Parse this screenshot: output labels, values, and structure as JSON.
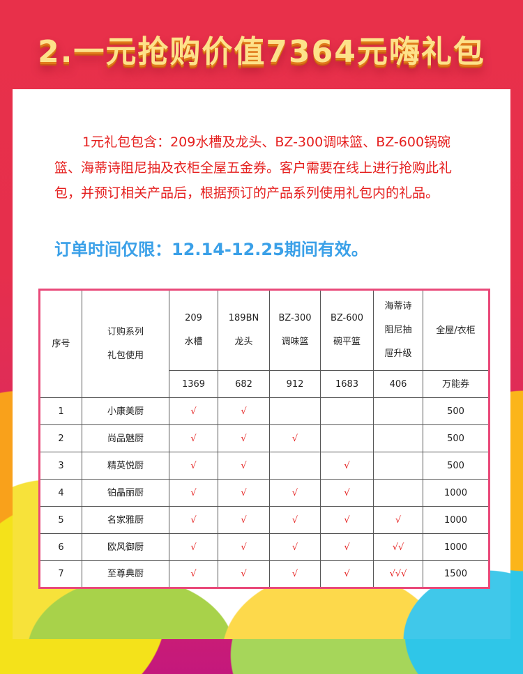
{
  "title": "2.一元抢购价值7364元嗨礼包",
  "intro": "1元礼包包含：209水槽及龙头、BZ-300调味篮、BZ-600锅碗篮、海蒂诗阻尼抽及衣柜全屋五金券。客户需要在线上进行抢购此礼包，并预订相关产品后，根据预订的产品系列使用礼包内的礼品。",
  "period": "订单时间仅限：12.14-12.25期间有效。",
  "table": {
    "h_no": "序号",
    "h_series_1": "订购系列",
    "h_series_2": "礼包使用",
    "cols": [
      {
        "l1": "209",
        "l2": "水槽",
        "value": "1369"
      },
      {
        "l1": "189BN",
        "l2": "龙头",
        "value": "682"
      },
      {
        "l1": "BZ-300",
        "l2": "调味篮",
        "value": "912"
      },
      {
        "l1": "BZ-600",
        "l2": "碗平篮",
        "value": "1683"
      },
      {
        "l1": "海蒂诗",
        "l2": "阻尼抽",
        "l3": "屉升级",
        "value": "406"
      }
    ],
    "h_last": "全屋/衣柜",
    "h_last_sub": "万能券",
    "rows": [
      {
        "no": "1",
        "name": "小康美厨",
        "c": [
          "√",
          "√",
          "",
          "",
          "",
          ""
        ],
        "v": "500"
      },
      {
        "no": "2",
        "name": "尚品魅厨",
        "c": [
          "√",
          "√",
          "√",
          "",
          ""
        ],
        "v": "500"
      },
      {
        "no": "3",
        "name": "精英悦厨",
        "c": [
          "√",
          "√",
          "",
          "√",
          ""
        ],
        "v": "500"
      },
      {
        "no": "4",
        "name": "铂晶丽厨",
        "c": [
          "√",
          "√",
          "√",
          "√",
          ""
        ],
        "v": "1000"
      },
      {
        "no": "5",
        "name": "名家雅厨",
        "c": [
          "√",
          "√",
          "√",
          "√",
          "√"
        ],
        "v": "1000"
      },
      {
        "no": "6",
        "name": "欧风御厨",
        "c": [
          "√",
          "√",
          "√",
          "√",
          "√√"
        ],
        "v": "1000"
      },
      {
        "no": "7",
        "name": "至尊典厨",
        "c": [
          "√",
          "√",
          "√",
          "√",
          "√√√"
        ],
        "v": "1500"
      }
    ]
  }
}
